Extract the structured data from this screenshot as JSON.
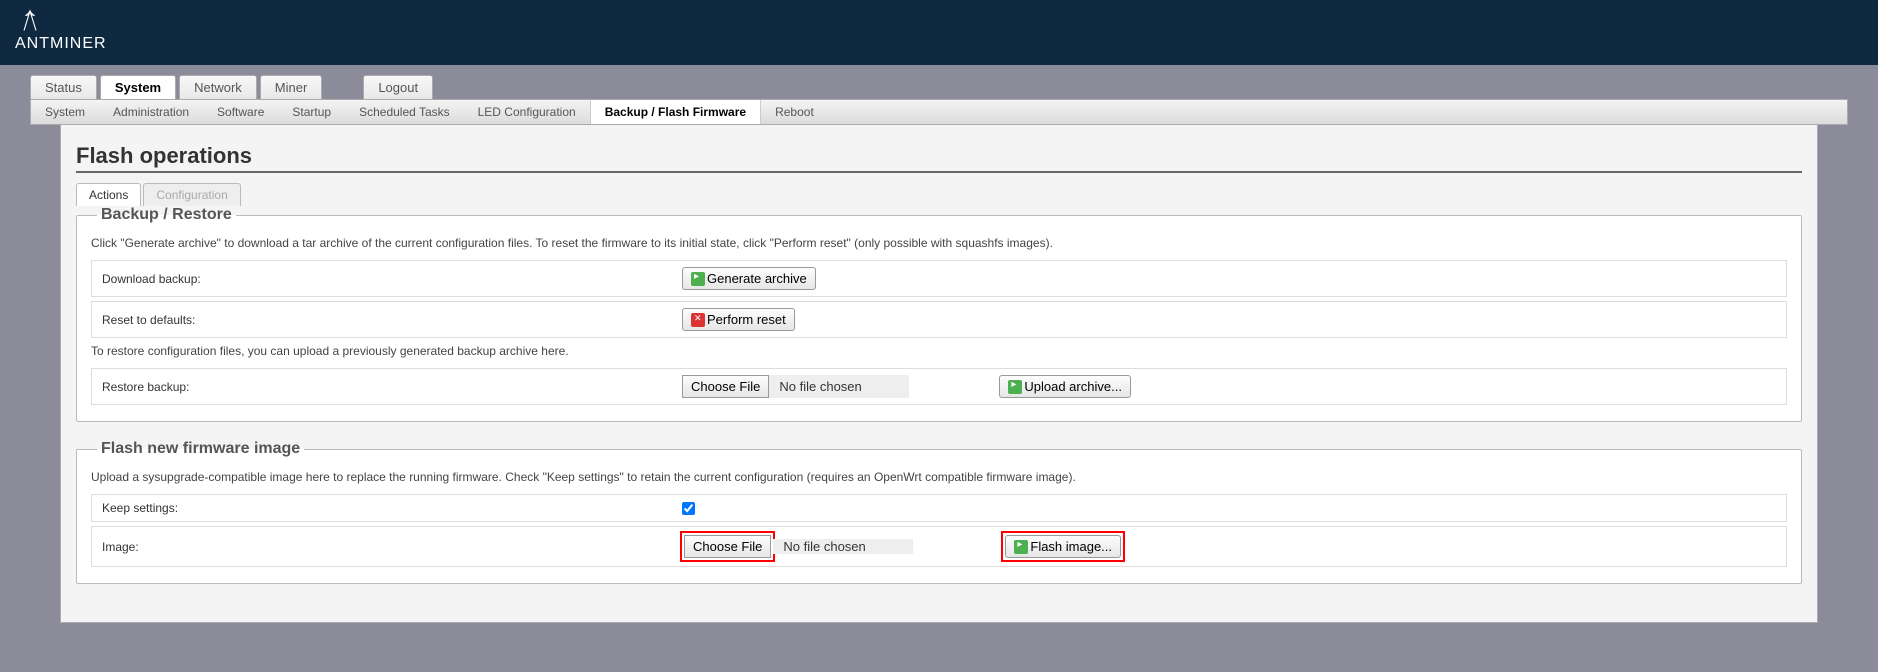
{
  "brand": "ANTMINER",
  "main_tabs": {
    "items": [
      {
        "label": "Status"
      },
      {
        "label": "System"
      },
      {
        "label": "Network"
      },
      {
        "label": "Miner"
      }
    ],
    "logout": "Logout",
    "active": "System"
  },
  "sub_tabs": {
    "items": [
      {
        "label": "System"
      },
      {
        "label": "Administration"
      },
      {
        "label": "Software"
      },
      {
        "label": "Startup"
      },
      {
        "label": "Scheduled Tasks"
      },
      {
        "label": "LED Configuration"
      },
      {
        "label": "Backup / Flash Firmware"
      },
      {
        "label": "Reboot"
      }
    ],
    "active": "Backup / Flash Firmware"
  },
  "page_title": "Flash operations",
  "inner_tabs": {
    "actions": "Actions",
    "configuration": "Configuration"
  },
  "backup_restore": {
    "legend": "Backup / Restore",
    "desc": "Click \"Generate archive\" to download a tar archive of the current configuration files. To reset the firmware to its initial state, click \"Perform reset\" (only possible with squashfs images).",
    "download_label": "Download backup:",
    "generate_btn": "Generate archive",
    "reset_label": "Reset to defaults:",
    "reset_btn": "Perform reset",
    "restore_desc": "To restore configuration files, you can upload a previously generated backup archive here.",
    "restore_label": "Restore backup:",
    "choose_file": "Choose File",
    "no_file": "No file chosen",
    "upload_btn": "Upload archive..."
  },
  "flash_firmware": {
    "legend": "Flash new firmware image",
    "desc": "Upload a sysupgrade-compatible image here to replace the running firmware. Check \"Keep settings\" to retain the current configuration (requires an OpenWrt compatible firmware image).",
    "keep_label": "Keep settings:",
    "image_label": "Image:",
    "choose_file": "Choose File",
    "no_file": "No file chosen",
    "flash_btn": "Flash image..."
  }
}
